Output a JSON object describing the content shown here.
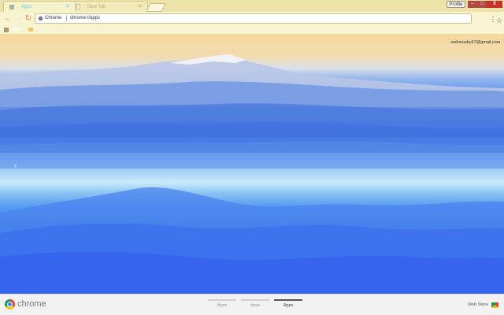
{
  "tabs": [
    {
      "label": "Apps",
      "close": "✕",
      "active": true
    },
    {
      "label": "New Tab",
      "close": "✕",
      "active": false
    }
  ],
  "window_controls": {
    "profile": "Profile",
    "minimize": "–",
    "maximize": "□",
    "close": "X"
  },
  "toolbar": {
    "back": "←",
    "forward": "→",
    "reload": "↻",
    "omnibox": {
      "scheme_label": "Chrome",
      "url": "chrome://apps"
    },
    "star": "☆",
    "menu": "⋮"
  },
  "bookmarks": {
    "apps_label": "Apps"
  },
  "content": {
    "user_email": "oxdonosby67@gmail.com",
    "prev_arrow": "‹"
  },
  "footer": {
    "brand": "chrome",
    "pages": [
      {
        "label": "Apps",
        "active": false
      },
      {
        "label": "Apps",
        "active": false
      },
      {
        "label": "Apps",
        "active": true
      }
    ],
    "web_store": "Web Store"
  },
  "colors": {
    "sky": "#f6d79e",
    "mist": "#c9ecfb",
    "mountain_blue": "#3464ee",
    "tab_text": "#5bd1ff",
    "close_button": "#c8312a",
    "toolbar_bg": "#f8f3d1"
  },
  "icons": {
    "back": "arrow-left-icon",
    "forward": "arrow-right-icon",
    "reload": "reload-icon",
    "bookmark": "star-icon",
    "menu": "menu-icon",
    "apps": "apps-grid-icon"
  }
}
